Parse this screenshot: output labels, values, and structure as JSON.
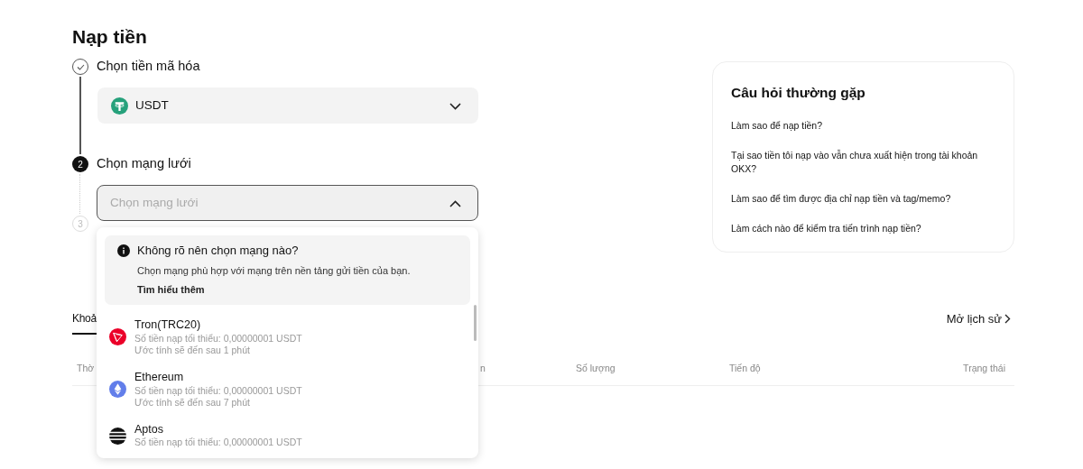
{
  "page": {
    "title": "Nạp tiền"
  },
  "steps": [
    {
      "kind": "done",
      "label": "Chọn tiền mã hóa"
    },
    {
      "kind": "active",
      "number": "2",
      "label": "Chọn mạng lưới"
    },
    {
      "kind": "pending",
      "number": "3"
    }
  ],
  "coin_select": {
    "value": "USDT",
    "expanded": false
  },
  "network_select": {
    "placeholder": "Chọn mạng lưới",
    "expanded": true
  },
  "dropdown": {
    "notice": {
      "title": "Không rõ nên chọn mạng nào?",
      "text": "Chọn mạng phù hợp với mạng trên nền tảng gửi tiền của bạn.",
      "link": "Tìm hiểu thêm"
    },
    "networks": [
      {
        "kind": "tron",
        "name": "Tron(TRC20)",
        "minimum": "Số tiền nạp tối thiểu: 0,00000001 USDT",
        "eta": "Ước tính sẽ đến sau 1 phút"
      },
      {
        "kind": "ethereum",
        "name": "Ethereum",
        "minimum": "Số tiền nạp tối thiểu: 0,00000001 USDT",
        "eta": "Ước tính sẽ đến sau 7 phút"
      },
      {
        "kind": "aptos",
        "name": "Aptos",
        "minimum": "Số tiền nạp tối thiểu: 0,00000001 USDT"
      }
    ]
  },
  "history": {
    "tabs": [
      {
        "label": "Khoả",
        "selected": true
      }
    ],
    "link": "Mở lịch sử",
    "columns": [
      "Thờ",
      "n",
      "Số lượng",
      "Tiến độ",
      "Trạng thái"
    ]
  },
  "faq": {
    "title": "Câu hỏi thường gặp",
    "questions": [
      "Làm sao để nạp tiền?",
      "Tại sao tiền tôi nạp vào vẫn chưa xuất hiện trong tài khoản OKX?",
      "Làm sao để tìm được địa chỉ nạp tiền và tag/memo?",
      "Làm cách nào để kiểm tra tiến trình nạp tiền?"
    ]
  }
}
